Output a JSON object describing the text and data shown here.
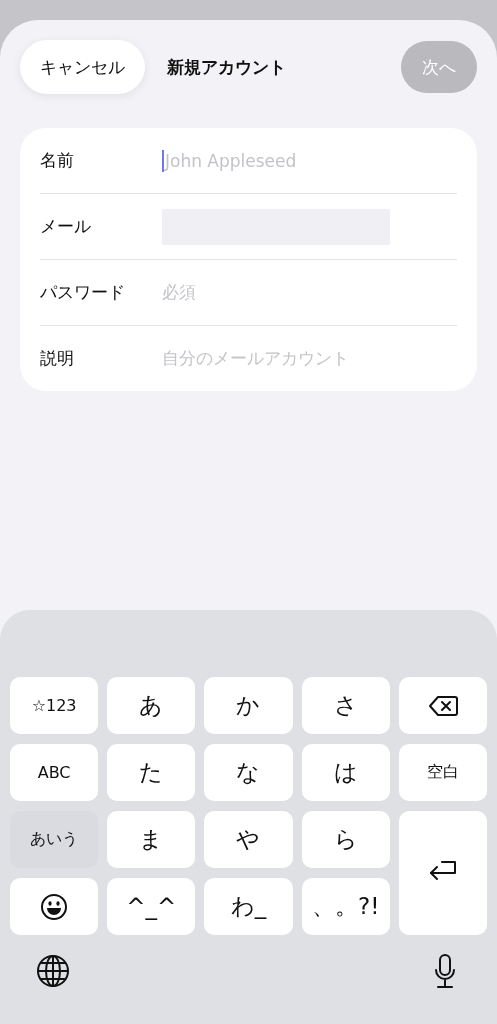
{
  "header": {
    "cancel": "キャンセル",
    "title": "新規アカウント",
    "next": {
      "label": "次へ",
      "disabled": true
    }
  },
  "fields": [
    {
      "label": "名前",
      "placeholder": "John Appleseed",
      "kind": "text",
      "focused": true
    },
    {
      "label": "メール",
      "kind": "redacted",
      "focused": false
    },
    {
      "label": "パスワード",
      "placeholder": "必須",
      "kind": "text",
      "focused": false
    },
    {
      "label": "説明",
      "placeholder": "自分のメールアカウント",
      "kind": "text",
      "focused": false
    }
  ],
  "keyboard": {
    "keys": [
      {
        "kind": "text",
        "label": "☆123"
      },
      {
        "kind": "char",
        "label": "あ"
      },
      {
        "kind": "char",
        "label": "か"
      },
      {
        "kind": "char",
        "label": "さ"
      },
      {
        "kind": "backspace"
      },
      {
        "kind": "text",
        "label": "ABC"
      },
      {
        "kind": "char",
        "label": "た"
      },
      {
        "kind": "char",
        "label": "な"
      },
      {
        "kind": "char",
        "label": "は"
      },
      {
        "kind": "text",
        "label": "空白"
      },
      {
        "kind": "current",
        "label": "あいう"
      },
      {
        "kind": "char",
        "label": "ま"
      },
      {
        "kind": "char",
        "label": "や"
      },
      {
        "kind": "char",
        "label": "ら"
      },
      {
        "kind": "enter"
      },
      {
        "kind": "emoji"
      },
      {
        "kind": "char",
        "label": "^_^"
      },
      {
        "kind": "char",
        "label": "わ_"
      },
      {
        "kind": "char",
        "label": "、。?!"
      }
    ]
  }
}
